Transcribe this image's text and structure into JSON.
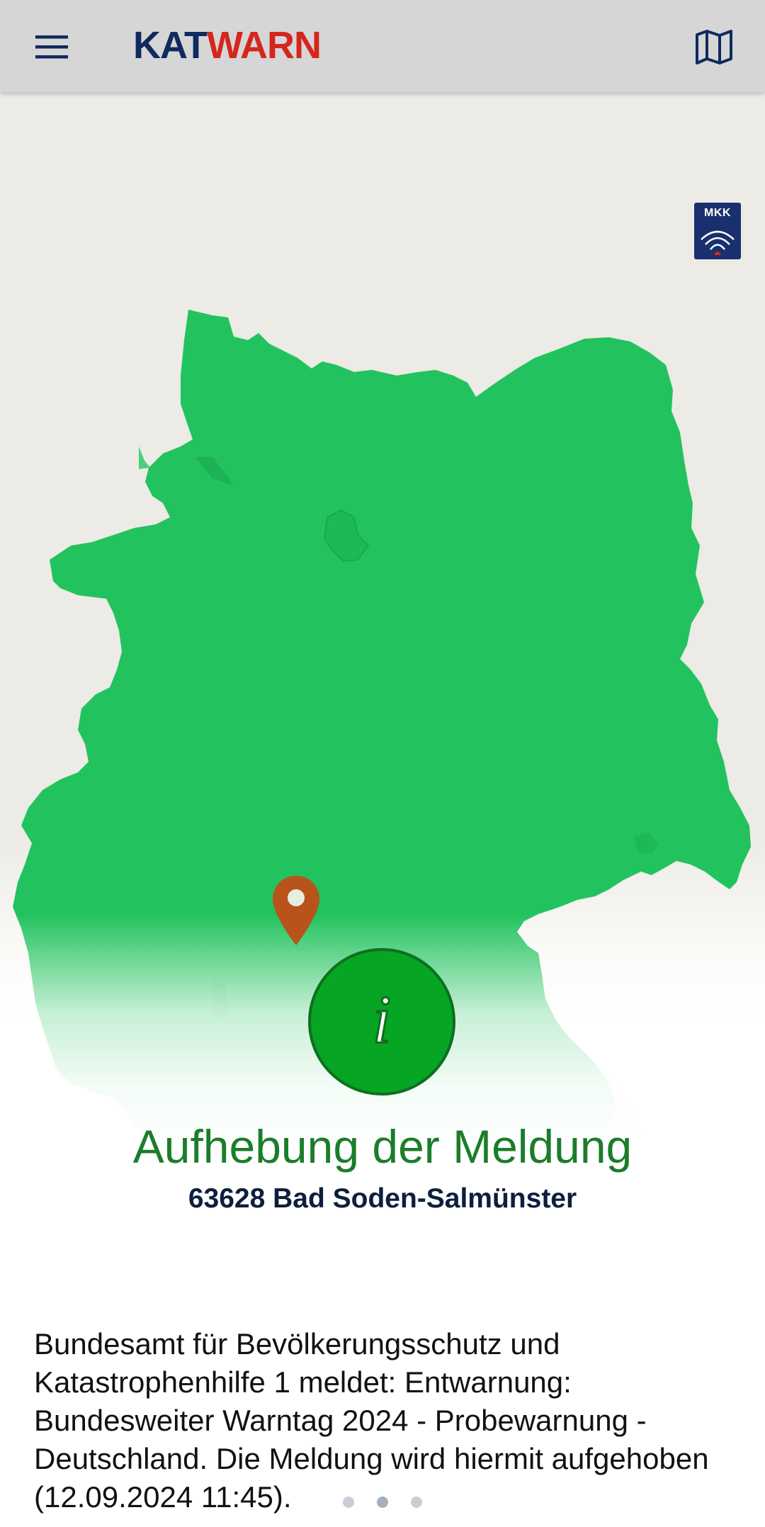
{
  "header": {
    "logo": {
      "part1": "KAT",
      "part2": "WARN"
    },
    "menu_icon": "hamburger-menu-icon",
    "map_icon": "map-book-icon"
  },
  "badge": {
    "label": "MKK"
  },
  "alert": {
    "title": "Aufhebung der Meldung",
    "location": "63628 Bad Soden-Salmünster",
    "message": "Bundesamt für Bevölkerungsschutz und Katastrophenhilfe 1 meldet: Entwarnung: Bundesweiter Warntag 2024 - Probewarnung - Deutschland. Die Meldung wird hiermit aufgehoben (12.09.2024 11:45)."
  },
  "pagination": {
    "count": 3,
    "active": 2
  },
  "colors": {
    "header_bg": "#d6d6d6",
    "logo_dark": "#0f2a5e",
    "logo_red": "#d5261e",
    "map_green": "#22c35e",
    "info_green": "#06a524",
    "title_green": "#1b7d2a",
    "pin_orange": "#b8531c"
  }
}
